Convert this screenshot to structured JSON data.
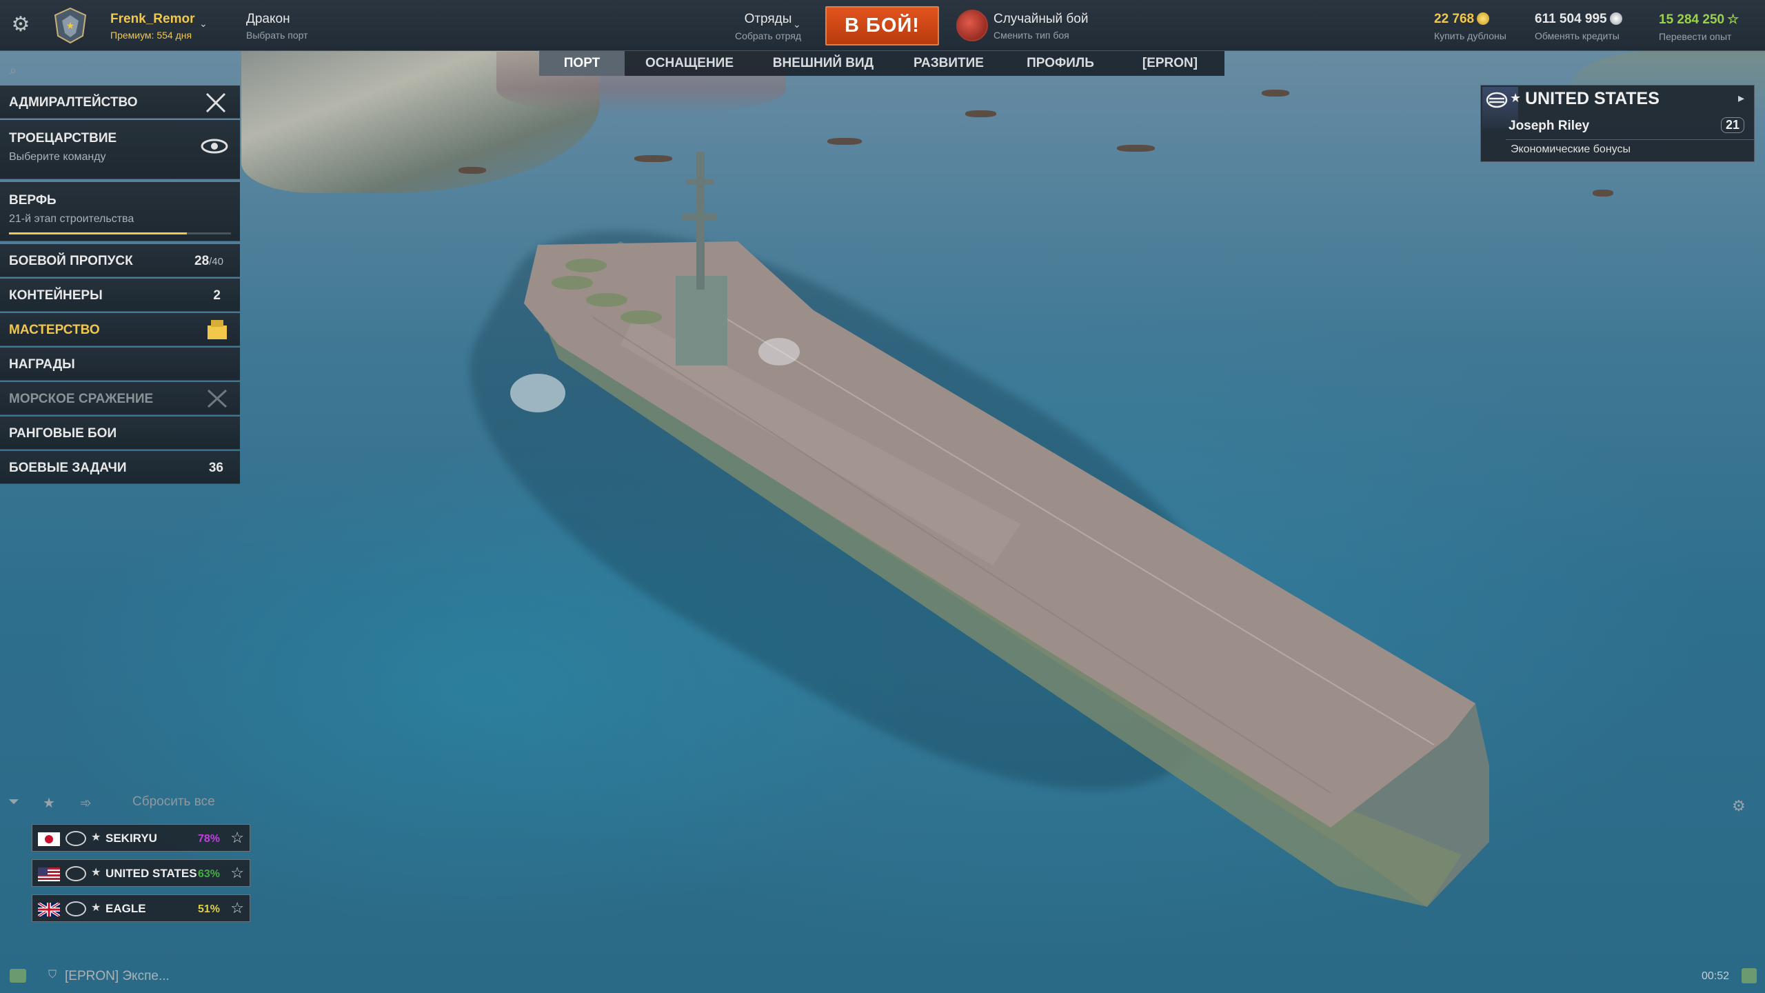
{
  "header": {
    "user_name": "Frenk_Remor",
    "premium": "Премиум: 554 дня",
    "port_name": "Дракон",
    "port_sub": "Выбрать порт",
    "divisions_title": "Отряды",
    "divisions_sub": "Собрать отряд",
    "battle_button": "В БОЙ!",
    "mode_title": "Случайный бой",
    "mode_sub": "Сменить тип боя",
    "doubloons": "22 768",
    "doubloons_sub": "Купить дублоны",
    "credits": "611 504 995",
    "credits_sub": "Обменять кредиты",
    "free_xp": "15 284 250",
    "free_xp_sub": "Перевести опыт"
  },
  "tabs": [
    "ПОРТ",
    "ОСНАЩЕНИЕ",
    "ВНЕШНИЙ ВИД",
    "РАЗВИТИЕ",
    "ПРОФИЛЬ",
    "[EPRON]"
  ],
  "menu": {
    "admiralty": "АДМИРАЛТЕЙСТВО",
    "triumvirate": "ТРОЕЦАРСТВИЕ",
    "triumvirate_sub": "Выберите команду",
    "shipyard": "ВЕРФЬ",
    "shipyard_sub": "21-й этап строительства",
    "shipyard_progress": 0.8,
    "battle_pass": "БОЕВОЙ ПРОПУСК",
    "battle_pass_count": "28",
    "battle_pass_total": "/40",
    "containers": "КОНТЕЙНЕРЫ",
    "containers_count": "2",
    "mastery": "МАСТЕРСТВО",
    "rewards": "НАГРАДЫ",
    "naval_battle": "МОРСКОЕ СРАЖЕНИЕ",
    "ranked": "РАНГОВЫЕ БОИ",
    "combat_missions": "БОЕВЫЕ ЗАДАЧИ",
    "combat_missions_count": "36"
  },
  "nation_panel": {
    "title": "UNITED STATES",
    "commander": "Joseph Riley",
    "commander_level": "21",
    "bonuses": "Экономические бонусы"
  },
  "carousel": {
    "reset_all": "Сбросить все",
    "ships": [
      {
        "name": "SEKIRYU",
        "pct": "78%",
        "pct_color": "#c040e0",
        "flag": "japan"
      },
      {
        "name": "UNITED STATES",
        "pct": "63%",
        "pct_color": "#40b040",
        "flag": "usa"
      },
      {
        "name": "EAGLE",
        "pct": "51%",
        "pct_color": "#e0d040",
        "flag": "uk"
      }
    ]
  },
  "footer": {
    "chat": "[EPRON] Экспе...",
    "time": "00:52"
  },
  "colors": {
    "accent_gold": "#f2c84b",
    "battle_button": "#d0481a"
  }
}
